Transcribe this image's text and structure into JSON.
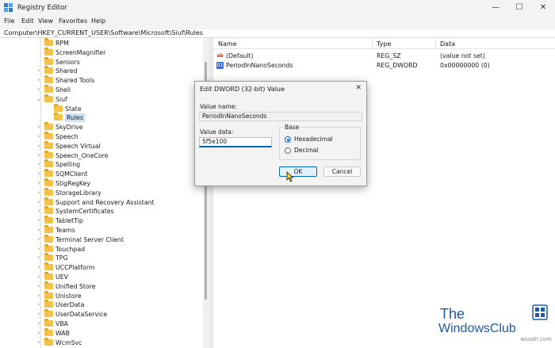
{
  "window": {
    "title": "Registry Editor",
    "minimize_glyph": "—",
    "maximize_glyph": "☐",
    "close_glyph": "✕"
  },
  "menu": [
    "File",
    "Edit",
    "View",
    "Favorites",
    "Help"
  ],
  "address": "Computer\\HKEY_CURRENT_USER\\Software\\Microsoft\\Siuf\\Rules",
  "tree": {
    "items": [
      {
        "label": "RPM",
        "chevron": "",
        "depth": 0
      },
      {
        "label": "ScreenMagnifier",
        "chevron": "",
        "depth": 0
      },
      {
        "label": "Sensors",
        "chevron": "",
        "depth": 0
      },
      {
        "label": "Shared",
        "chevron": "›",
        "depth": 0
      },
      {
        "label": "Shared Tools",
        "chevron": "›",
        "depth": 0
      },
      {
        "label": "Shell",
        "chevron": "›",
        "depth": 0
      },
      {
        "label": "Siuf",
        "chevron": "⌄",
        "depth": 0
      },
      {
        "label": "State",
        "chevron": "",
        "depth": 1
      },
      {
        "label": "Rules",
        "chevron": "",
        "depth": 1,
        "selected": true
      },
      {
        "label": "SkyDrive",
        "chevron": "›",
        "depth": 0
      },
      {
        "label": "Speech",
        "chevron": "›",
        "depth": 0
      },
      {
        "label": "Speech Virtual",
        "chevron": "›",
        "depth": 0
      },
      {
        "label": "Speech_OneCore",
        "chevron": "›",
        "depth": 0
      },
      {
        "label": "Spelling",
        "chevron": "›",
        "depth": 0
      },
      {
        "label": "SQMClient",
        "chevron": "›",
        "depth": 0
      },
      {
        "label": "StigRegKey",
        "chevron": "›",
        "depth": 0
      },
      {
        "label": "StorageLibrary",
        "chevron": "›",
        "depth": 0
      },
      {
        "label": "Support and Recovery Assistant",
        "chevron": "›",
        "depth": 0
      },
      {
        "label": "SystemCertificates",
        "chevron": "›",
        "depth": 0
      },
      {
        "label": "TabletTip",
        "chevron": "›",
        "depth": 0
      },
      {
        "label": "Teams",
        "chevron": "›",
        "depth": 0
      },
      {
        "label": "Terminal Server Client",
        "chevron": "›",
        "depth": 0
      },
      {
        "label": "Touchpad",
        "chevron": "›",
        "depth": 0
      },
      {
        "label": "TPG",
        "chevron": "›",
        "depth": 0
      },
      {
        "label": "UCCPlatform",
        "chevron": "›",
        "depth": 0
      },
      {
        "label": "UEV",
        "chevron": "›",
        "depth": 0
      },
      {
        "label": "Unified Store",
        "chevron": "›",
        "depth": 0
      },
      {
        "label": "Unistore",
        "chevron": "›",
        "depth": 0
      },
      {
        "label": "UserData",
        "chevron": "›",
        "depth": 0
      },
      {
        "label": "UserDataService",
        "chevron": "›",
        "depth": 0
      },
      {
        "label": "VBA",
        "chevron": "›",
        "depth": 0
      },
      {
        "label": "WAB",
        "chevron": "›",
        "depth": 0
      },
      {
        "label": "WcmSvc",
        "chevron": "›",
        "depth": 0
      }
    ]
  },
  "values": {
    "columns": {
      "name": "Name",
      "type": "Type",
      "data": "Data"
    },
    "rows": [
      {
        "icon": "string-value-icon",
        "icon_glyph": "ab",
        "name": "(Default)",
        "type": "REG_SZ",
        "data": "(value not set)"
      },
      {
        "icon": "dword-value-icon",
        "icon_glyph": "01",
        "name": "PeriodInNanoSeconds",
        "type": "REG_DWORD",
        "data": "0x00000000 (0)"
      }
    ]
  },
  "dialog": {
    "title": "Edit DWORD (32-bit) Value",
    "value_name_label": "Value name:",
    "value_name": "PeriodInNanoSeconds",
    "value_data_label": "Value data:",
    "value_data": "5f5e100",
    "base_label": "Base",
    "base_options": [
      "Hexadecimal",
      "Decimal"
    ],
    "base_selected": "Hexadecimal",
    "ok_label": "OK",
    "cancel_label": "Cancel"
  },
  "watermark": {
    "line1": "The",
    "line2": "WindowsClub",
    "site": "wsxdn.com"
  },
  "colors": {
    "accent": "#0067c0",
    "folder": "#f2c24a",
    "selection": "#cce4f7",
    "watermark": "#1f5aa6"
  }
}
